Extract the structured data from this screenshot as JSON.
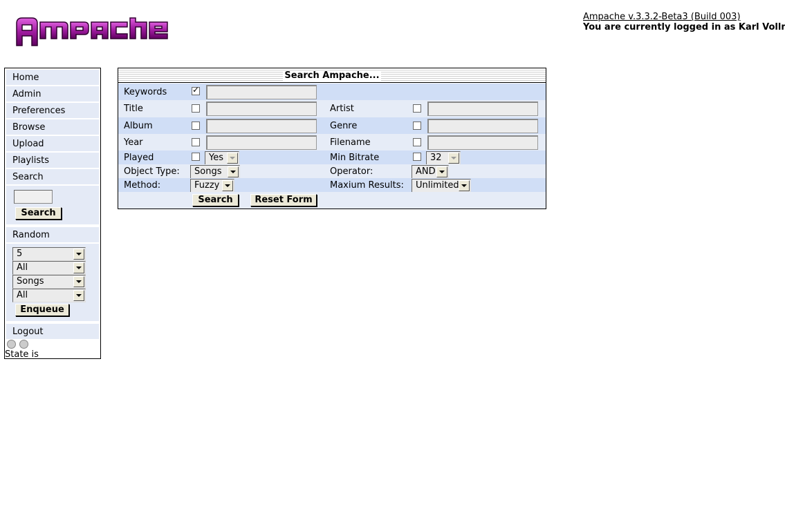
{
  "app": {
    "logo_text": "Ampache",
    "version_link": "Ampache v.3.3.2-Beta3 (Build 003)",
    "login_text": "You are currently logged in as Karl Vollmer"
  },
  "sidebar": {
    "items": [
      {
        "label": "Home"
      },
      {
        "label": "Admin"
      },
      {
        "label": "Preferences"
      },
      {
        "label": "Browse"
      },
      {
        "label": "Upload"
      },
      {
        "label": "Playlists"
      },
      {
        "label": "Search"
      }
    ],
    "search_button": "Search",
    "random_label": "Random",
    "random_selects": [
      "5",
      "All",
      "Songs",
      "All"
    ],
    "enqueue_button": "Enqueue",
    "logout_label": "Logout",
    "state_text": "State is"
  },
  "search_panel": {
    "title": "Search Ampache...",
    "keywords_label": "Keywords",
    "keywords_checked": true,
    "title_label": "Title",
    "artist_label": "Artist",
    "album_label": "Album",
    "genre_label": "Genre",
    "year_label": "Year",
    "filename_label": "Filename",
    "played_label": "Played",
    "played_value": "Yes",
    "min_bitrate_label": "Min Bitrate",
    "min_bitrate_value": "32",
    "object_type_label": "Object Type:",
    "object_type_value": "Songs",
    "operator_label": "Operator:",
    "operator_value": "AND",
    "method_label": "Method:",
    "method_value": "Fuzzy",
    "max_results_label": "Maxium Results:",
    "max_results_value": "Unlimited",
    "search_button": "Search",
    "reset_button": "Reset Form"
  },
  "colors": {
    "row_dark": "#d0def6",
    "row_light": "#e6ecf7",
    "logo": "#a020a0"
  }
}
